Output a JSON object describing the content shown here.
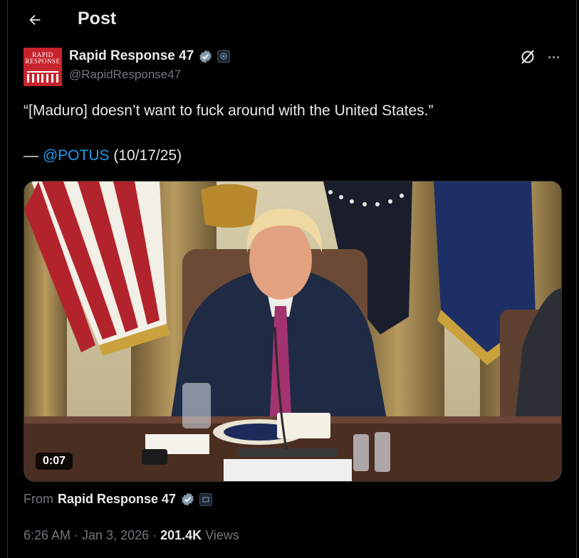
{
  "header": {
    "title": "Post",
    "back_icon": "arrow-left-icon"
  },
  "author": {
    "name": "Rapid Response 47",
    "handle": "@RapidResponse47",
    "avatar_line1": "RAPID",
    "avatar_line2": "RESPONSE",
    "verified_color": "#829aab",
    "brand_color": "#c8232c"
  },
  "post": {
    "line1": "“[Maduro] doesn’t want to fuck around with the United States.”",
    "attribution_dash": "— ",
    "mention": "@POTUS",
    "date_note": " (10/17/25)"
  },
  "media": {
    "duration": "0:07"
  },
  "source": {
    "label": "From",
    "name": "Rapid Response 47"
  },
  "meta": {
    "time": "6:26 AM",
    "date": "Jan 3, 2026",
    "views_count": "201.4K",
    "views_label": "Views"
  },
  "colors": {
    "link": "#1d9bf0",
    "muted": "#71767b",
    "text": "#e7e9ea",
    "background": "#000000"
  }
}
